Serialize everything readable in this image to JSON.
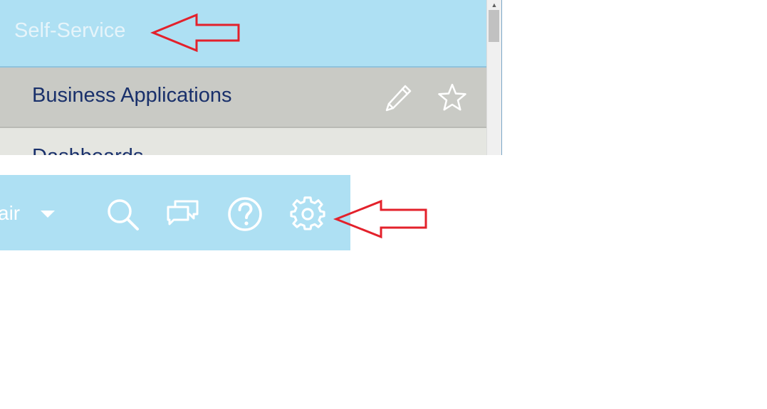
{
  "navigator": {
    "header_title": "Self-Service",
    "items": [
      {
        "label": "Business Applications",
        "state": "selected"
      },
      {
        "label": "Dashboards",
        "state": "partially-visible"
      }
    ],
    "row_icons": [
      "pencil-icon",
      "star-icon"
    ]
  },
  "header": {
    "user_name_partial": "air",
    "icons": [
      "chevron-down-icon",
      "search-icon",
      "chat-icon",
      "help-icon",
      "gear-icon"
    ]
  },
  "colors": {
    "header_bg": "#aee0f3",
    "selected_row_bg": "#c9cac5",
    "row_bg": "#e5e6e1",
    "nav_text": "#19306b",
    "annotation_red": "#e3212b"
  }
}
